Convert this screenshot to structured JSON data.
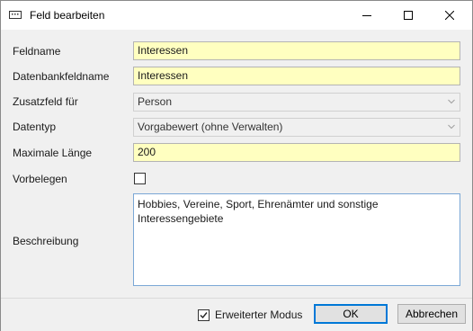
{
  "window": {
    "title": "Feld bearbeiten",
    "icon": "edit-field-icon"
  },
  "title_buttons": {
    "minimize": "minimize-icon",
    "maximize": "maximize-icon",
    "close": "close-icon"
  },
  "form": {
    "feldname": {
      "label": "Feldname",
      "value": "Interessen"
    },
    "datenbankfeldname": {
      "label": "Datenbankfeldname",
      "value": "Interessen"
    },
    "zusatzfeld": {
      "label": "Zusatzfeld für",
      "value": "Person"
    },
    "datentyp": {
      "label": "Datentyp",
      "value": "Vorgabewert (ohne Verwalten)"
    },
    "maxlaenge": {
      "label": "Maximale Länge",
      "value": "200"
    },
    "vorbelegen": {
      "label": "Vorbelegen",
      "checked": false
    },
    "beschreibung": {
      "label": "Beschreibung",
      "value": "Hobbies, Vereine, Sport, Ehrenämter und sonstige Interessengebiete"
    }
  },
  "footer": {
    "extended_mode_label": "Erweiterter Modus",
    "extended_mode_checked": true,
    "ok_label": "OK",
    "cancel_label": "Abbrechen"
  },
  "colors": {
    "required_field": "#ffffc0",
    "focus_border": "#0078d7"
  }
}
